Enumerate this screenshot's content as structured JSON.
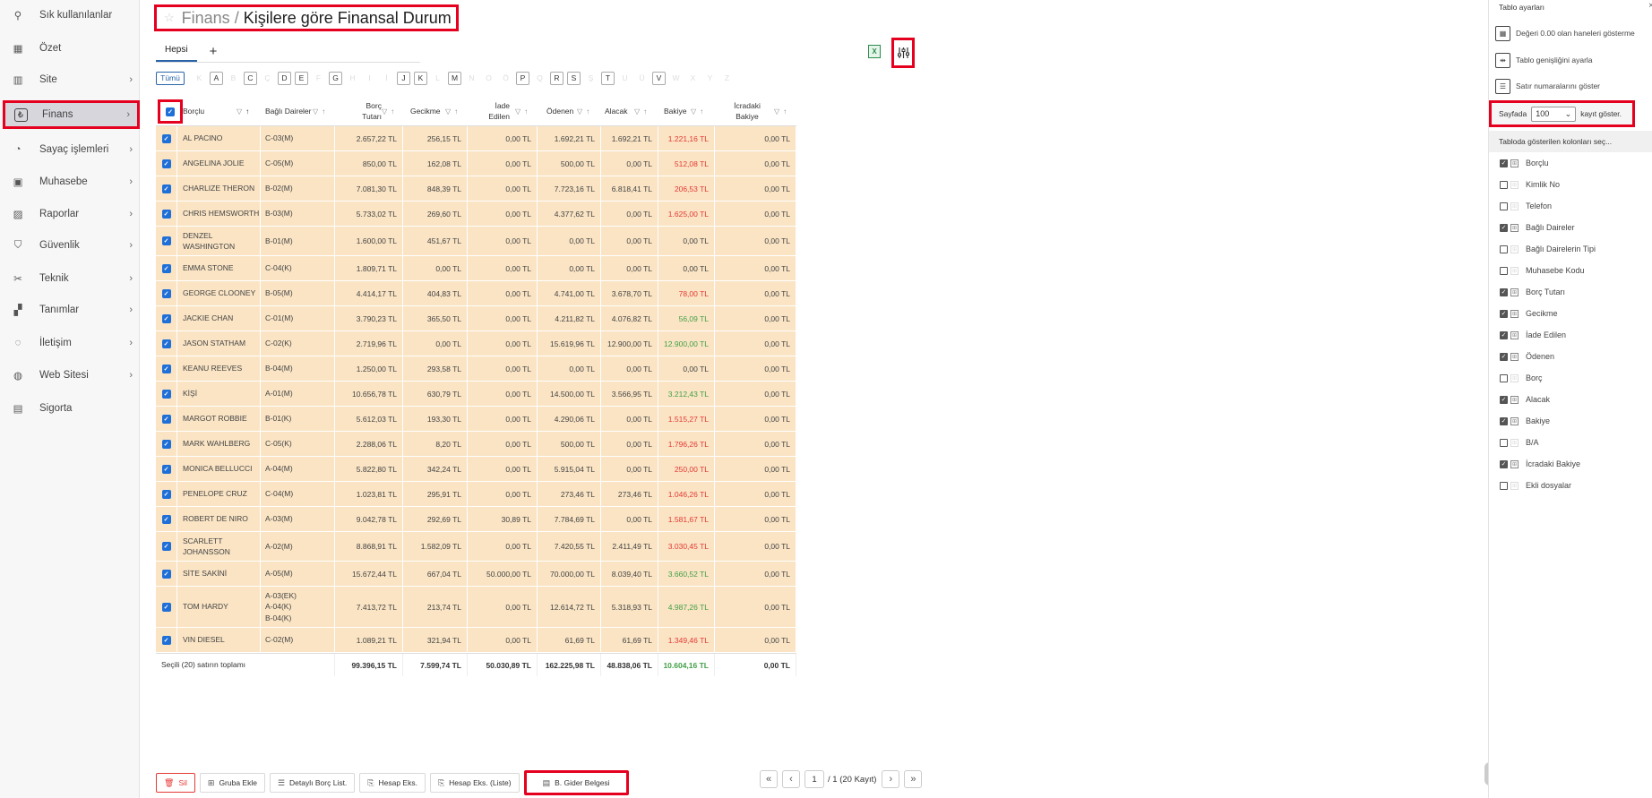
{
  "sidebar": {
    "items": [
      {
        "label": "Sık kullanılanlar",
        "icon": "pin-icon",
        "chevron": false
      },
      {
        "label": "Özet",
        "icon": "layout-icon",
        "chevron": false
      },
      {
        "label": "Site",
        "icon": "building-icon",
        "chevron": true
      },
      {
        "label": "Finans",
        "icon": "lira-icon",
        "chevron": true,
        "active": true
      },
      {
        "label": "Sayaç işlemleri",
        "icon": "gauge-icon",
        "chevron": true
      },
      {
        "label": "Muhasebe",
        "icon": "briefcase-icon",
        "chevron": true
      },
      {
        "label": "Raporlar",
        "icon": "chart-icon",
        "chevron": true
      },
      {
        "label": "Güvenlik",
        "icon": "shield-icon",
        "chevron": true
      },
      {
        "label": "Teknik",
        "icon": "tools-icon",
        "chevron": true
      },
      {
        "label": "Tanımlar",
        "icon": "grid-plus-icon",
        "chevron": true
      },
      {
        "label": "İletişim",
        "icon": "chat-icon",
        "chevron": true
      },
      {
        "label": "Web Sitesi",
        "icon": "globe-icon",
        "chevron": true
      },
      {
        "label": "Sigorta",
        "icon": "document-icon",
        "chevron": false
      }
    ]
  },
  "header": {
    "breadcrumb": "Finans",
    "separator": "/",
    "title": "Kişilere göre Finansal Durum"
  },
  "tabs": [
    {
      "label": "Hepsi"
    }
  ],
  "letters": {
    "all_label": "Tümü",
    "items": [
      {
        "l": "K",
        "on": false
      },
      {
        "l": "A",
        "on": true
      },
      {
        "l": "B",
        "on": false
      },
      {
        "l": "C",
        "on": true
      },
      {
        "l": "Ç",
        "on": false
      },
      {
        "l": "D",
        "on": true
      },
      {
        "l": "E",
        "on": true
      },
      {
        "l": "F",
        "on": false
      },
      {
        "l": "G",
        "on": true
      },
      {
        "l": "H",
        "on": false
      },
      {
        "l": "I",
        "on": false
      },
      {
        "l": "İ",
        "on": false
      },
      {
        "l": "J",
        "on": true
      },
      {
        "l": "K",
        "on": true
      },
      {
        "l": "L",
        "on": false
      },
      {
        "l": "M",
        "on": true
      },
      {
        "l": "N",
        "on": false
      },
      {
        "l": "O",
        "on": false
      },
      {
        "l": "Ö",
        "on": false
      },
      {
        "l": "P",
        "on": true
      },
      {
        "l": "Q",
        "on": false
      },
      {
        "l": "R",
        "on": true
      },
      {
        "l": "S",
        "on": true
      },
      {
        "l": "Ş",
        "on": false
      },
      {
        "l": "T",
        "on": true
      },
      {
        "l": "U",
        "on": false
      },
      {
        "l": "Ü",
        "on": false
      },
      {
        "l": "V",
        "on": true
      },
      {
        "l": "W",
        "on": false
      },
      {
        "l": "X",
        "on": false
      },
      {
        "l": "Y",
        "on": false
      },
      {
        "l": "Z",
        "on": false
      }
    ]
  },
  "table": {
    "columns": [
      "Borçlu",
      "Bağlı Daireler",
      "Borç Tutarı",
      "Gecikme",
      "İade Edilen",
      "Ödenen",
      "Alacak",
      "Bakiye",
      "İcradaki Bakiye"
    ],
    "rows": [
      {
        "name": "AL PACINO",
        "unit": "C-03(M)",
        "borc": "2.657,22 TL",
        "gecikme": "256,15 TL",
        "iade": "0,00 TL",
        "odenen": "1.692,21 TL",
        "alacak": "1.692,21 TL",
        "bakiye": "1.221,16 TL",
        "tone": "red",
        "icra": "0,00 TL"
      },
      {
        "name": "ANGELINA JOLIE",
        "unit": "C-05(M)",
        "borc": "850,00 TL",
        "gecikme": "162,08 TL",
        "iade": "0,00 TL",
        "odenen": "500,00 TL",
        "alacak": "0,00 TL",
        "bakiye": "512,08 TL",
        "tone": "red",
        "icra": "0,00 TL"
      },
      {
        "name": "CHARLIZE THERON",
        "unit": "B-02(M)",
        "borc": "7.081,30 TL",
        "gecikme": "848,39 TL",
        "iade": "0,00 TL",
        "odenen": "7.723,16 TL",
        "alacak": "6.818,41 TL",
        "bakiye": "206,53 TL",
        "tone": "red",
        "icra": "0,00 TL"
      },
      {
        "name": "CHRIS HEMSWORTH",
        "unit": "B-03(M)",
        "borc": "5.733,02 TL",
        "gecikme": "269,60 TL",
        "iade": "0,00 TL",
        "odenen": "4.377,62 TL",
        "alacak": "0,00 TL",
        "bakiye": "1.625,00 TL",
        "tone": "red",
        "icra": "0,00 TL"
      },
      {
        "name": "DENZEL\nWASHINGTON",
        "unit": "B-01(M)",
        "borc": "1.600,00 TL",
        "gecikme": "451,67 TL",
        "iade": "0,00 TL",
        "odenen": "0,00 TL",
        "alacak": "0,00 TL",
        "bakiye": "0,00 TL",
        "tone": "",
        "icra": "0,00 TL"
      },
      {
        "name": "EMMA STONE",
        "unit": "C-04(K)",
        "borc": "1.809,71 TL",
        "gecikme": "0,00 TL",
        "iade": "0,00 TL",
        "odenen": "0,00 TL",
        "alacak": "0,00 TL",
        "bakiye": "0,00 TL",
        "tone": "",
        "icra": "0,00 TL"
      },
      {
        "name": "GEORGE CLOONEY",
        "unit": "B-05(M)",
        "borc": "4.414,17 TL",
        "gecikme": "404,83 TL",
        "iade": "0,00 TL",
        "odenen": "4.741,00 TL",
        "alacak": "3.678,70 TL",
        "bakiye": "78,00 TL",
        "tone": "red",
        "icra": "0,00 TL"
      },
      {
        "name": "JACKIE CHAN",
        "unit": "C-01(M)",
        "borc": "3.790,23 TL",
        "gecikme": "365,50 TL",
        "iade": "0,00 TL",
        "odenen": "4.211,82 TL",
        "alacak": "4.076,82 TL",
        "bakiye": "56,09 TL",
        "tone": "green",
        "icra": "0,00 TL"
      },
      {
        "name": "JASON STATHAM",
        "unit": "C-02(K)",
        "borc": "2.719,96 TL",
        "gecikme": "0,00 TL",
        "iade": "0,00 TL",
        "odenen": "15.619,96 TL",
        "alacak": "12.900,00 TL",
        "bakiye": "12.900,00 TL",
        "tone": "green",
        "icra": "0,00 TL"
      },
      {
        "name": "KEANU REEVES",
        "unit": "B-04(M)",
        "borc": "1.250,00 TL",
        "gecikme": "293,58 TL",
        "iade": "0,00 TL",
        "odenen": "0,00 TL",
        "alacak": "0,00 TL",
        "bakiye": "0,00 TL",
        "tone": "",
        "icra": "0,00 TL"
      },
      {
        "name": "KİŞİ",
        "unit": "A-01(M)",
        "borc": "10.656,78 TL",
        "gecikme": "630,79 TL",
        "iade": "0,00 TL",
        "odenen": "14.500,00 TL",
        "alacak": "3.566,95 TL",
        "bakiye": "3.212,43 TL",
        "tone": "green",
        "icra": "0,00 TL"
      },
      {
        "name": "MARGOT ROBBIE",
        "unit": "B-01(K)",
        "borc": "5.612,03 TL",
        "gecikme": "193,30 TL",
        "iade": "0,00 TL",
        "odenen": "4.290,06 TL",
        "alacak": "0,00 TL",
        "bakiye": "1.515,27 TL",
        "tone": "red",
        "icra": "0,00 TL"
      },
      {
        "name": "MARK WAHLBERG",
        "unit": "C-05(K)",
        "borc": "2.288,06 TL",
        "gecikme": "8,20 TL",
        "iade": "0,00 TL",
        "odenen": "500,00 TL",
        "alacak": "0,00 TL",
        "bakiye": "1.796,26 TL",
        "tone": "red",
        "icra": "0,00 TL"
      },
      {
        "name": "MONICA BELLUCCI",
        "unit": "A-04(M)",
        "borc": "5.822,80 TL",
        "gecikme": "342,24 TL",
        "iade": "0,00 TL",
        "odenen": "5.915,04 TL",
        "alacak": "0,00 TL",
        "bakiye": "250,00 TL",
        "tone": "red",
        "icra": "0,00 TL"
      },
      {
        "name": "PENELOPE CRUZ",
        "unit": "C-04(M)",
        "borc": "1.023,81 TL",
        "gecikme": "295,91 TL",
        "iade": "0,00 TL",
        "odenen": "273,46 TL",
        "alacak": "273,46 TL",
        "bakiye": "1.046,26 TL",
        "tone": "red",
        "icra": "0,00 TL"
      },
      {
        "name": "ROBERT DE NIRO",
        "unit": "A-03(M)",
        "borc": "9.042,78 TL",
        "gecikme": "292,69 TL",
        "iade": "30,89 TL",
        "odenen": "7.784,69 TL",
        "alacak": "0,00 TL",
        "bakiye": "1.581,67 TL",
        "tone": "red",
        "icra": "0,00 TL"
      },
      {
        "name": "SCARLETT\nJOHANSSON",
        "unit": "A-02(M)",
        "borc": "8.868,91 TL",
        "gecikme": "1.582,09 TL",
        "iade": "0,00 TL",
        "odenen": "7.420,55 TL",
        "alacak": "2.411,49 TL",
        "bakiye": "3.030,45 TL",
        "tone": "red",
        "icra": "0,00 TL"
      },
      {
        "name": "SİTE SAKİNİ",
        "unit": "A-05(M)",
        "borc": "15.672,44 TL",
        "gecikme": "667,04 TL",
        "iade": "50.000,00 TL",
        "odenen": "70.000,00 TL",
        "alacak": "8.039,40 TL",
        "bakiye": "3.660,52 TL",
        "tone": "green",
        "icra": "0,00 TL"
      },
      {
        "name": "TOM HARDY",
        "unit": "A-03(EK)\nA-04(K)\nB-04(K)",
        "borc": "7.413,72 TL",
        "gecikme": "213,74 TL",
        "iade": "0,00 TL",
        "odenen": "12.614,72 TL",
        "alacak": "5.318,93 TL",
        "bakiye": "4.987,26 TL",
        "tone": "green",
        "icra": "0,00 TL"
      },
      {
        "name": "VIN DIESEL",
        "unit": "C-02(M)",
        "borc": "1.089,21 TL",
        "gecikme": "321,94 TL",
        "iade": "0,00 TL",
        "odenen": "61,69 TL",
        "alacak": "61,69 TL",
        "bakiye": "1.349,46 TL",
        "tone": "red",
        "icra": "0,00 TL"
      }
    ],
    "totals": {
      "label": "Seçili (20) satırın toplamı",
      "borc": "99.396,15 TL",
      "gecikme": "7.599,74 TL",
      "iade": "50.030,89 TL",
      "odenen": "162.225,98 TL",
      "alacak": "48.838,06 TL",
      "bakiye": "10.604,16 TL",
      "icra": "0,00 TL"
    }
  },
  "footer": {
    "buttons": [
      {
        "label": "Sil",
        "icon": "trash-icon",
        "name": "delete-button",
        "style": "del"
      },
      {
        "label": "Gruba Ekle",
        "icon": "group-icon",
        "name": "add-to-group-button",
        "style": ""
      },
      {
        "label": "Detaylı Borç List.",
        "icon": "list-icon",
        "name": "detailed-debt-list-button",
        "style": ""
      },
      {
        "label": "Hesap Eks.",
        "icon": "statement-icon",
        "name": "account-statement-button",
        "style": ""
      },
      {
        "label": "Hesap Eks. (Liste)",
        "icon": "statement-icon",
        "name": "account-statement-list-button",
        "style": ""
      },
      {
        "label": "B. Gider Belgesi",
        "icon": "document-icon",
        "name": "expense-document-button",
        "style": "hl"
      }
    ],
    "pager": {
      "page": "1",
      "info": "/ 1 (20 Kayıt)"
    }
  },
  "panel": {
    "title": "Tablo ayarları",
    "close": "×",
    "options": [
      {
        "label": "Değeri 0.00 olan haneleri gösterme",
        "icon": "zero-grid-icon"
      },
      {
        "label": "Tablo genişliğini ayarla",
        "icon": "width-icon"
      },
      {
        "label": "Satır numaralarını göster",
        "icon": "list-lines-icon"
      }
    ],
    "page_size": {
      "prefix": "Sayfada",
      "value": "100",
      "suffix": "kayıt göster."
    },
    "columns_title": "Tabloda gösterilen kolonları seç...",
    "columns": [
      {
        "label": "Borçlu",
        "checked": true
      },
      {
        "label": "Kimlik No",
        "checked": false
      },
      {
        "label": "Telefon",
        "checked": false
      },
      {
        "label": "Bağlı Daireler",
        "checked": true
      },
      {
        "label": "Bağlı Dairelerin Tipi",
        "checked": false
      },
      {
        "label": "Muhasebe Kodu",
        "checked": false
      },
      {
        "label": "Borç Tutarı",
        "checked": true
      },
      {
        "label": "Gecikme",
        "checked": true
      },
      {
        "label": "İade Edilen",
        "checked": true
      },
      {
        "label": "Ödenen",
        "checked": true
      },
      {
        "label": "Borç",
        "checked": false
      },
      {
        "label": "Alacak",
        "checked": true
      },
      {
        "label": "Bakiye",
        "checked": true
      },
      {
        "label": "B/A",
        "checked": false
      },
      {
        "label": "İcradaki Bakiye",
        "checked": true
      },
      {
        "label": "Ekli dosyalar",
        "checked": false
      }
    ]
  },
  "colors": {
    "accent": "#2a64a8",
    "highlight": "#e5001f",
    "row_bg": "#fae4c4",
    "negative": "#e53935",
    "positive": "#43a047",
    "checkbox": "#1f6fd8"
  }
}
